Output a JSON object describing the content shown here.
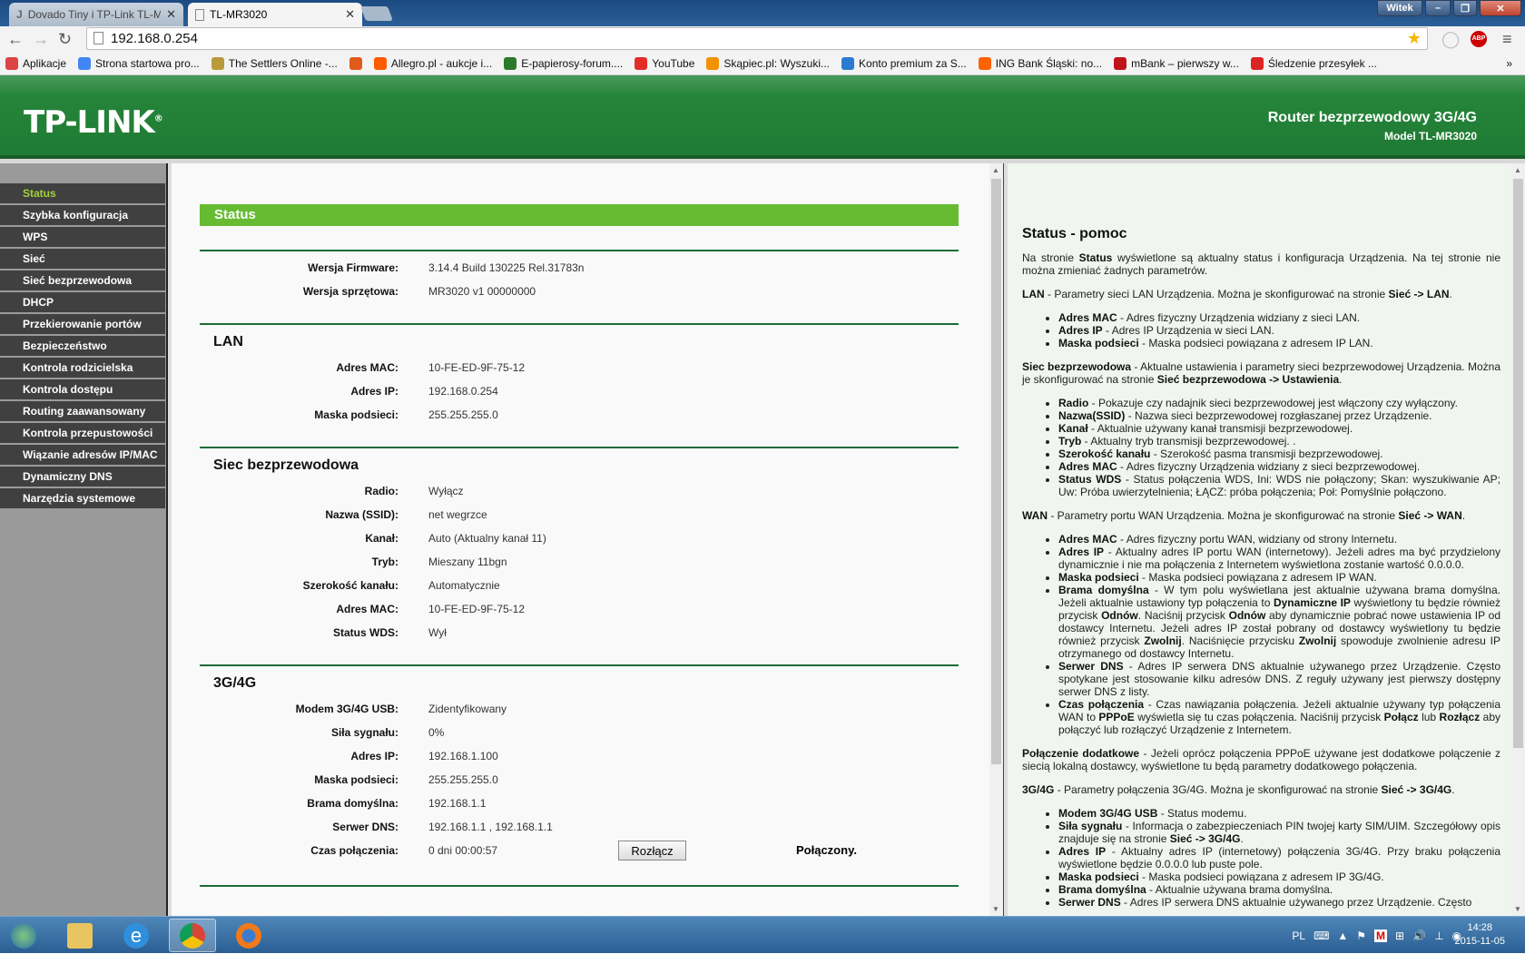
{
  "browser": {
    "tabs": [
      {
        "title": "Dovado Tiny i TP-Link TL-M",
        "active": false
      },
      {
        "title": "TL-MR3020",
        "active": true
      }
    ],
    "user": "Witek",
    "url": "192.168.0.254",
    "bookmarks": [
      {
        "label": "Aplikacje",
        "icon": "apps-grid-icon",
        "color": "#d44"
      },
      {
        "label": "Strona startowa pro...",
        "icon": "google-icon",
        "color": "#4285f4"
      },
      {
        "label": "The Settlers Online -...",
        "icon": "settlers-icon",
        "color": "#b89a3a"
      },
      {
        "label": "",
        "icon": "cda-icon",
        "color": "#e05a1a"
      },
      {
        "label": "Allegro.pl - aukcje i...",
        "icon": "allegro-icon",
        "color": "#ff5a00"
      },
      {
        "label": "E-papierosy-forum....",
        "icon": "epf-icon",
        "color": "#2a7a2a"
      },
      {
        "label": "YouTube",
        "icon": "youtube-icon",
        "color": "#e52d27"
      },
      {
        "label": "Skąpiec.pl: Wyszuki...",
        "icon": "skapiec-icon",
        "color": "#f39200"
      },
      {
        "label": "Konto premium za S...",
        "icon": "chevron-icon",
        "color": "#2b7bd0"
      },
      {
        "label": "ING Bank Śląski: no...",
        "icon": "ing-icon",
        "color": "#ff6200"
      },
      {
        "label": "mBank – pierwszy w...",
        "icon": "mbank-icon",
        "color": "#c0141b"
      },
      {
        "label": "Śledzenie przesyłek ...",
        "icon": "poczta-icon",
        "color": "#d22"
      }
    ],
    "bookmarks_more": "»"
  },
  "header": {
    "logo": "TP-LINK",
    "title": "Router bezprzewodowy 3G/4G",
    "model": "Model TL-MR3020"
  },
  "menu": [
    "Status",
    "Szybka konfiguracja",
    "WPS",
    "Sieć",
    "Sieć bezprzewodowa",
    "DHCP",
    "Przekierowanie portów",
    "Bezpieczeństwo",
    "Kontrola rodzicielska",
    "Kontrola dostępu",
    "Routing zaawansowany",
    "Kontrola przepustowości",
    "Wiązanie adresów IP/MAC",
    "Dynamiczny DNS",
    "Narzędzia systemowe"
  ],
  "menu_selected": 0,
  "main": {
    "title": "Status",
    "sections": [
      {
        "title": "",
        "rows": [
          {
            "label": "Wersja Firmware:",
            "value": "3.14.4 Build 130225 Rel.31783n"
          },
          {
            "label": "Wersja sprzętowa:",
            "value": "MR3020 v1 00000000"
          }
        ]
      },
      {
        "title": "LAN",
        "rows": [
          {
            "label": "Adres MAC:",
            "value": "10-FE-ED-9F-75-12"
          },
          {
            "label": "Adres IP:",
            "value": "192.168.0.254"
          },
          {
            "label": "Maska podsieci:",
            "value": "255.255.255.0"
          }
        ]
      },
      {
        "title": "Siec bezprzewodowa",
        "rows": [
          {
            "label": "Radio:",
            "value": "Wyłącz"
          },
          {
            "label": "Nazwa (SSID):",
            "value": "net wegrzce"
          },
          {
            "label": "Kanał:",
            "value": "Auto (Aktualny kanał 11)"
          },
          {
            "label": "Tryb:",
            "value": "Mieszany 11bgn"
          },
          {
            "label": "Szerokość kanału:",
            "value": "Automatycznie"
          },
          {
            "label": "Adres MAC:",
            "value": "10-FE-ED-9F-75-12"
          },
          {
            "label": "Status WDS:",
            "value": "Wył"
          }
        ]
      },
      {
        "title": "3G/4G",
        "rows": [
          {
            "label": "Modem 3G/4G USB:",
            "value": "Zidentyfikowany"
          },
          {
            "label": "Siła sygnału:",
            "value": "0%"
          },
          {
            "label": "Adres IP:",
            "value": "192.168.1.100"
          },
          {
            "label": "Maska podsieci:",
            "value": "255.255.255.0"
          },
          {
            "label": "Brama domyślna:",
            "value": "192.168.1.1"
          },
          {
            "label": "Serwer DNS:",
            "value": "192.168.1.1 , 192.168.1.1"
          },
          {
            "label": "Czas połączenia:",
            "value": "0 dni 00:00:57"
          }
        ]
      }
    ],
    "disconnect_button": "Rozłącz",
    "connection_status": "Połączony."
  },
  "help": {
    "title": "Status - pomoc",
    "blocks": [
      {
        "type": "p",
        "segs": [
          [
            "",
            "Na stronie "
          ],
          [
            "b",
            "Status"
          ],
          [
            "",
            " wyświetlone są aktualny status i konfiguracja Urządzenia. Na tej stronie nie można zmieniać żadnych parametrów."
          ]
        ]
      },
      {
        "type": "p",
        "segs": [
          [
            "b",
            "LAN"
          ],
          [
            "",
            " - Parametry sieci LAN Urządzenia. Można je skonfigurować na stronie "
          ],
          [
            "b",
            "Sieć -> LAN"
          ],
          [
            "",
            "."
          ]
        ]
      },
      {
        "type": "ul",
        "items": [
          [
            [
              "b",
              "Adres MAC"
            ],
            [
              "",
              " - Adres fizyczny Urządzenia widziany z sieci LAN."
            ]
          ],
          [
            [
              "b",
              "Adres IP"
            ],
            [
              "",
              " - Adres IP Urządzenia w sieci LAN."
            ]
          ],
          [
            [
              "b",
              "Maska podsieci"
            ],
            [
              "",
              " - Maska podsieci powiązana z adresem IP LAN."
            ]
          ]
        ]
      },
      {
        "type": "p",
        "segs": [
          [
            "b",
            "Siec bezprzewodowa"
          ],
          [
            "",
            " - Aktualne ustawienia i parametry sieci bezprzewodowej Urządzenia. Można je skonfigurować na stronie "
          ],
          [
            "b",
            "Sieć bezprzewodowa -> Ustawienia"
          ],
          [
            "",
            "."
          ]
        ]
      },
      {
        "type": "ul",
        "items": [
          [
            [
              "b",
              "Radio"
            ],
            [
              "",
              " - Pokazuje czy nadajnik sieci bezprzewodowej jest włączony czy wyłączony."
            ]
          ],
          [
            [
              "b",
              "Nazwa(SSID)"
            ],
            [
              "",
              " - Nazwa sieci bezprzewodowej rozgłaszanej przez Urządzenie."
            ]
          ],
          [
            [
              "b",
              "Kanał"
            ],
            [
              "",
              " - Aktualnie używany kanał transmisji bezprzewodowej."
            ]
          ],
          [
            [
              "b",
              "Tryb"
            ],
            [
              "",
              " - Aktualny tryb transmisji bezprzewodowej. ."
            ]
          ],
          [
            [
              "b",
              "Szerokość kanału"
            ],
            [
              "",
              " - Szerokość pasma transmisji bezprzewodowej."
            ]
          ],
          [
            [
              "b",
              "Adres MAC"
            ],
            [
              "",
              " - Adres fizyczny Urządzenia widziany z sieci bezprzewodowej."
            ]
          ],
          [
            [
              "b",
              "Status WDS"
            ],
            [
              "",
              " - Status połączenia WDS, Ini: WDS nie połączony; Skan: wyszukiwanie AP; Uw: Próba uwierzytelnienia; ŁĄCZ: próba połączenia; Poł: Pomyślnie połączono."
            ]
          ]
        ]
      },
      {
        "type": "p",
        "segs": [
          [
            "b",
            "WAN"
          ],
          [
            "",
            " - Parametry portu WAN Urządzenia. Można je skonfigurować na stronie "
          ],
          [
            "b",
            "Sieć -> WAN"
          ],
          [
            "",
            "."
          ]
        ]
      },
      {
        "type": "ul",
        "items": [
          [
            [
              "b",
              "Adres MAC"
            ],
            [
              "",
              " - Adres fizyczny portu WAN, widziany od strony Internetu."
            ]
          ],
          [
            [
              "b",
              "Adres IP"
            ],
            [
              "",
              " - Aktualny adres IP portu WAN (internetowy). Jeżeli adres ma być przydzielony dynamicznie i nie ma połączenia z Internetem wyświetlona zostanie wartość 0.0.0.0."
            ]
          ],
          [
            [
              "b",
              "Maska podsieci"
            ],
            [
              "",
              " - Maska podsieci powiązana z adresem IP WAN."
            ]
          ],
          [
            [
              "b",
              "Brama domyślna"
            ],
            [
              "",
              " - W tym polu wyświetlana jest aktualnie używana brama domyślna. Jeżeli aktualnie ustawiony typ połączenia to "
            ],
            [
              "b",
              "Dynamiczne IP"
            ],
            [
              "",
              " wyświetlony tu będzie również przycisk "
            ],
            [
              "b",
              "Odnów"
            ],
            [
              "",
              ". Naciśnij przycisk "
            ],
            [
              "b",
              "Odnów"
            ],
            [
              "",
              " aby dynamicznie pobrać nowe ustawienia IP od dostawcy Internetu. Jeżeli adres IP został pobrany od dostawcy wyświetlony tu będzie również przycisk "
            ],
            [
              "b",
              "Zwolnij"
            ],
            [
              "",
              ". Naciśnięcie przycisku "
            ],
            [
              "b",
              "Zwolnij"
            ],
            [
              "",
              " spowoduje zwolnienie adresu IP otrzymanego od dostawcy Internetu."
            ]
          ],
          [
            [
              "b",
              "Serwer DNS"
            ],
            [
              "",
              " - Adres IP serwera DNS aktualnie używanego przez Urządzenie. Często spotykane jest stosowanie kilku adresów DNS. Z reguły używany jest pierwszy dostępny serwer DNS z listy."
            ]
          ],
          [
            [
              "b",
              "Czas połączenia"
            ],
            [
              "",
              " - Czas nawiązania połączenia. Jeżeli aktualnie używany typ połączenia WAN to "
            ],
            [
              "b",
              "PPPoE"
            ],
            [
              "",
              " wyświetla się tu czas połączenia. Naciśnij przycisk "
            ],
            [
              "b",
              "Połącz"
            ],
            [
              "",
              " lub "
            ],
            [
              "b",
              "Rozłącz"
            ],
            [
              "",
              " aby połączyć lub rozłączyć Urządzenie z Internetem."
            ]
          ]
        ]
      },
      {
        "type": "p",
        "segs": [
          [
            "b",
            "Połączenie dodatkowe"
          ],
          [
            "",
            " - Jeżeli oprócz połączenia PPPoE używane jest dodatkowe połączenie z siecią lokalną dostawcy, wyświetlone tu będą parametry dodatkowego połączenia."
          ]
        ]
      },
      {
        "type": "p",
        "segs": [
          [
            "b",
            "3G/4G"
          ],
          [
            "",
            " - Parametry połączenia 3G/4G. Można je skonfigurować na stronie "
          ],
          [
            "b",
            "Sieć -> 3G/4G"
          ],
          [
            "",
            "."
          ]
        ]
      },
      {
        "type": "ul",
        "items": [
          [
            [
              "b",
              "Modem 3G/4G USB"
            ],
            [
              "",
              " - Status modemu."
            ]
          ],
          [
            [
              "b",
              "Siła sygnału"
            ],
            [
              "",
              " - Informacja o zabezpieczeniach PIN twojej karty SIM/UIM. Szczegółowy opis znajduje się na stronie "
            ],
            [
              "b",
              "Sieć -> 3G/4G"
            ],
            [
              "",
              "."
            ]
          ],
          [
            [
              "b",
              "Adres IP"
            ],
            [
              "",
              " - Aktualny adres IP (internetowy) połączenia 3G/4G. Przy braku połączenia wyświetlone będzie 0.0.0.0 lub puste pole."
            ]
          ],
          [
            [
              "b",
              "Maska podsieci"
            ],
            [
              "",
              " - Maska podsieci powiązana z adresem IP 3G/4G."
            ]
          ],
          [
            [
              "b",
              "Brama domyślna"
            ],
            [
              "",
              " - Aktualnie używana brama domyślna."
            ]
          ],
          [
            [
              "b",
              "Serwer DNS"
            ],
            [
              "",
              " - Adres IP serwera DNS aktualnie używanego przez Urządzenie. Często"
            ]
          ]
        ]
      }
    ]
  },
  "taskbar": {
    "apps": [
      "start-orb",
      "explorer",
      "internet-explorer",
      "chrome",
      "firefox"
    ],
    "language": "PL",
    "time": "14:28",
    "date": "2015-11-05"
  }
}
